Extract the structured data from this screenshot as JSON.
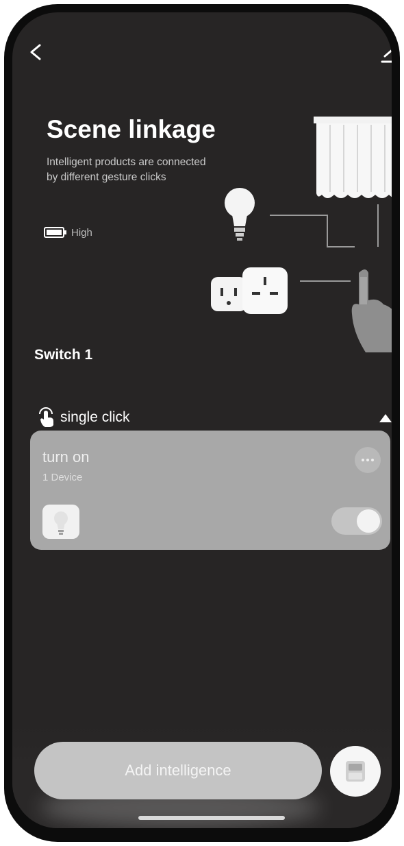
{
  "nav": {
    "back_icon": "chevron-left-icon",
    "edit_icon": "edit-icon"
  },
  "hero": {
    "title": "Scene linkage",
    "description": "Intelligent products are connected by different gesture clicks",
    "battery_label": "High",
    "battery_icon": "battery-icon",
    "illustration_icons": [
      "curtain-icon",
      "bulb-icon",
      "socket-icon",
      "hand-pointer-icon"
    ]
  },
  "switch": {
    "title": "Switch 1"
  },
  "gesture": {
    "label": "single click",
    "icon": "tap-gesture-icon",
    "expanded": true
  },
  "action_card": {
    "title": "turn on",
    "subtitle": "1 Device",
    "device_icon": "bulb-icon",
    "enabled": true
  },
  "footer": {
    "add_label": "Add intelligence",
    "side_icon": "switch-panel-icon"
  },
  "colors": {
    "background": "#272525",
    "card": "#a8a8a8",
    "button": "#c4c4c4",
    "text_primary": "#ffffff"
  }
}
